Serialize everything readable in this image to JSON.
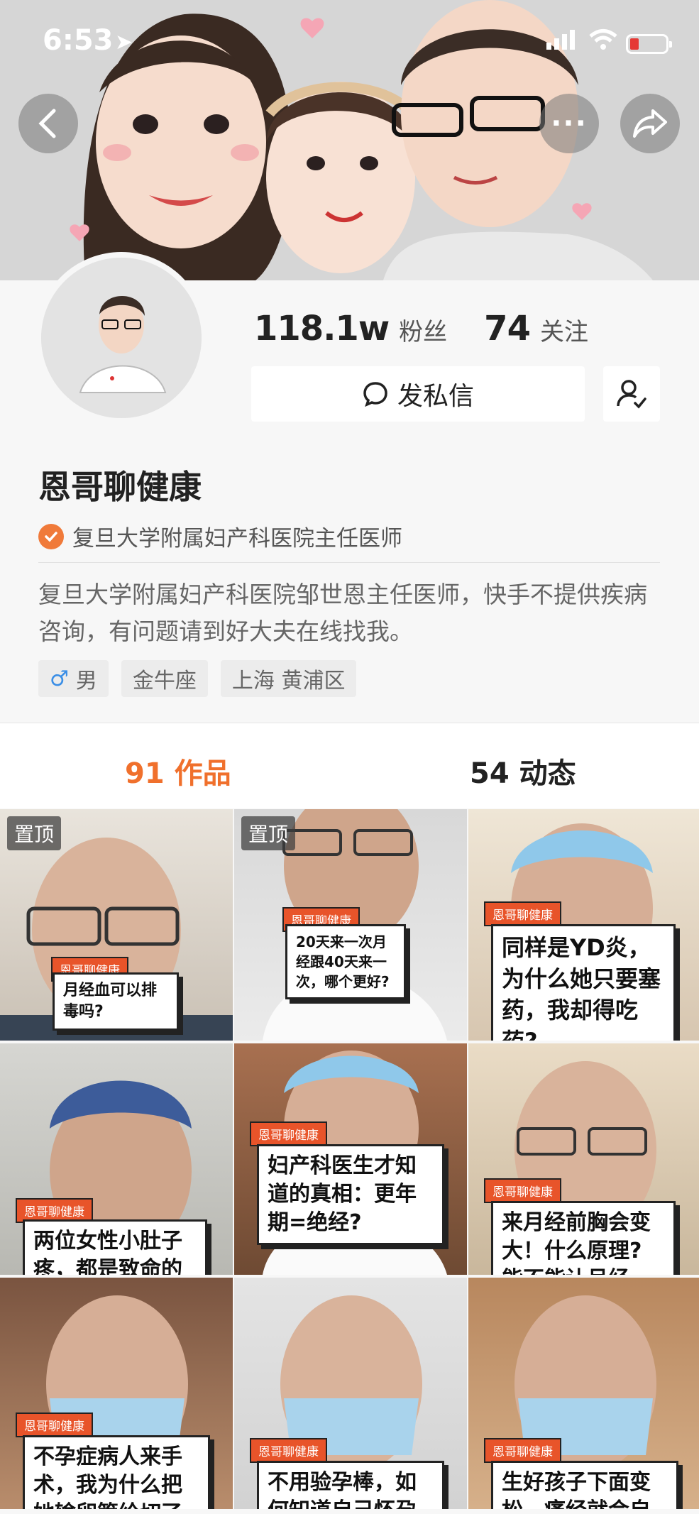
{
  "status_bar": {
    "time": "6:53",
    "location_arrow": "➤"
  },
  "nav": {
    "back_icon": "chevron-left-icon",
    "more_label": "···",
    "share_icon": "share-icon"
  },
  "profile": {
    "followers_count": "118.1w",
    "followers_label": "粉丝",
    "following_count": "74",
    "following_label": "关注",
    "message_button": "发私信",
    "name": "恩哥聊健康",
    "verification": "复旦大学附属妇产科医院主任医师",
    "bio": "复旦大学附属妇产科医院邹世恩主任医师，快手不提供疾病咨询，有问题请到好大夫在线找我。",
    "tags": {
      "gender_symbol": "♂",
      "gender": "男",
      "zodiac": "金牛座",
      "location": "上海 黄浦区"
    }
  },
  "tabs": {
    "works_count": "91",
    "works_label": "作品",
    "posts_count": "54",
    "posts_label": "动态"
  },
  "videos": [
    {
      "pinned_label": "置顶",
      "ribbon": "恩哥聊健康",
      "title": "月经血可以排毒吗?"
    },
    {
      "pinned_label": "置顶",
      "ribbon": "恩哥聊健康",
      "title": "20天来一次月经跟40天来一次，哪个更好?"
    },
    {
      "ribbon": "恩哥聊健康",
      "title": "同样是YD炎，为什么她只要塞药，我却得吃药?"
    },
    {
      "ribbon": "恩哥聊健康",
      "title": "两位女性小肚子疼，都是致命的"
    },
    {
      "ribbon": "恩哥聊健康",
      "title": "妇产科医生才知道的真相：更年期=绝经?"
    },
    {
      "ribbon": "恩哥聊健康",
      "title": "来月经前胸会变大！什么原理? 能不能让月经"
    },
    {
      "ribbon": "恩哥聊健康",
      "title": "不孕症病人来手术，我为什么把她输卵管给切了"
    },
    {
      "ribbon": "恩哥聊健康",
      "title": "不用验孕棒，如何知道自己怀孕"
    },
    {
      "ribbon": "恩哥聊健康",
      "title": "生好孩子下面变松，痛经就会自"
    }
  ]
}
